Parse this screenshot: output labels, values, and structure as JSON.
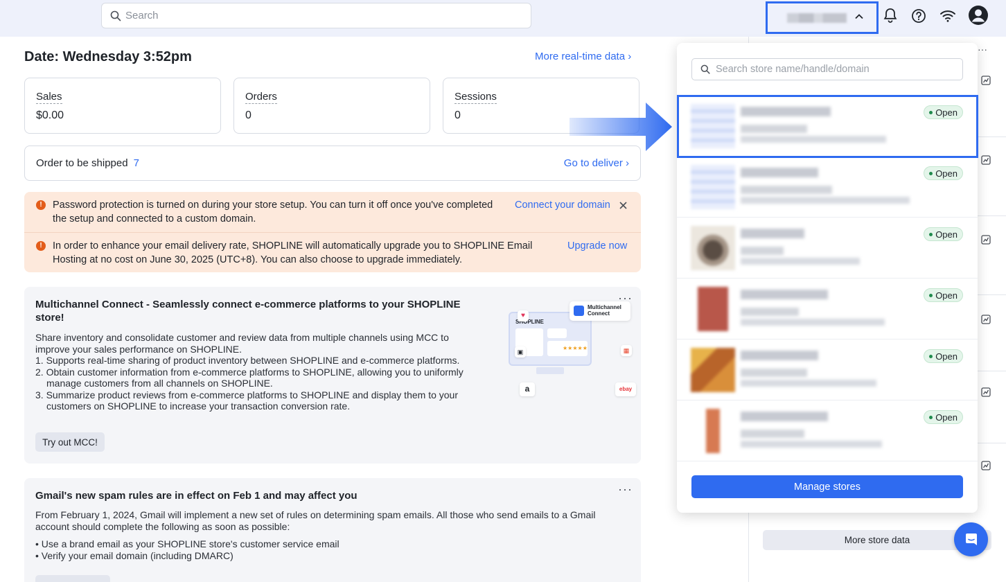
{
  "topbar": {
    "search_placeholder": "Search",
    "icons": [
      "search-icon",
      "chevron-up-icon",
      "bell-icon",
      "help-icon",
      "wifi-icon",
      "avatar-icon"
    ]
  },
  "main": {
    "date_label": "Date: Wednesday 3:52pm",
    "realtime_link": "More real-time data",
    "stats": [
      {
        "label": "Sales",
        "value": "$0.00"
      },
      {
        "label": "Orders",
        "value": "0"
      },
      {
        "label": "Sessions",
        "value": "0"
      }
    ],
    "shipping": {
      "label": "Order to be shipped",
      "count": "7",
      "action": "Go to deliver"
    },
    "warnings": [
      {
        "text": "Password protection is turned on during your store setup. You can turn it off once you've completed the setup and connected to a custom domain.",
        "action": "Connect your domain"
      },
      {
        "text": "In order to enhance your email delivery rate, SHOPLINE will automatically upgrade you to SHOPLINE Email Hosting at no cost on June 30, 2025 (UTC+8). You can also choose to upgrade immediately.",
        "action": "Upgrade now"
      }
    ],
    "mcc_card": {
      "title": "Multichannel Connect - Seamlessly connect e-commerce platforms to your SHOPLINE store!",
      "intro": "Share inventory and consolidate customer and review data from multiple channels using MCC to improve your sales performance on SHOPLINE.",
      "points": [
        "1. Supports real-time sharing of product inventory between SHOPLINE and e-commerce platforms.",
        "2. Obtain customer information from e-commerce platforms to SHOPLINE, allowing you to uniformly manage customers from all channels on SHOPLINE.",
        "3. Summarize product reviews from e-commerce platforms to SHOPLINE and display them to your customers on SHOPLINE to increase your transaction conversion rate."
      ],
      "button": "Try out MCC!",
      "illustration_badge": "Multichannel Connect",
      "illustration_brand": "SHOPLINE",
      "marketplaces": [
        "amazon",
        "ebay"
      ]
    },
    "gmail_card": {
      "title": "Gmail's new spam rules are in effect on Feb 1 and may affect you",
      "intro": "From February 1, 2024, Gmail will implement a new set of rules on determining spam emails. All those who send emails to a Gmail account should complete the following as soon as possible:",
      "points": [
        "Use a brand email as your SHOPLINE store's customer service email",
        "Verify your email domain (including DMARC)"
      ]
    }
  },
  "sidebar": {
    "more_store_data": "More store data"
  },
  "dropdown": {
    "search_placeholder": "Search store name/handle/domain",
    "stores": [
      {
        "status": "Open",
        "thumb_color": "#dfe6fb"
      },
      {
        "status": "Open",
        "thumb_color": "#dfe6fb"
      },
      {
        "status": "Open",
        "thumb_color": "#8a7b70"
      },
      {
        "status": "Open",
        "thumb_color": "#b8574a"
      },
      {
        "status": "Open",
        "thumb_color": "#c9862f"
      },
      {
        "status": "Open",
        "thumb_color": "#d77a52"
      }
    ],
    "manage_button": "Manage stores"
  }
}
